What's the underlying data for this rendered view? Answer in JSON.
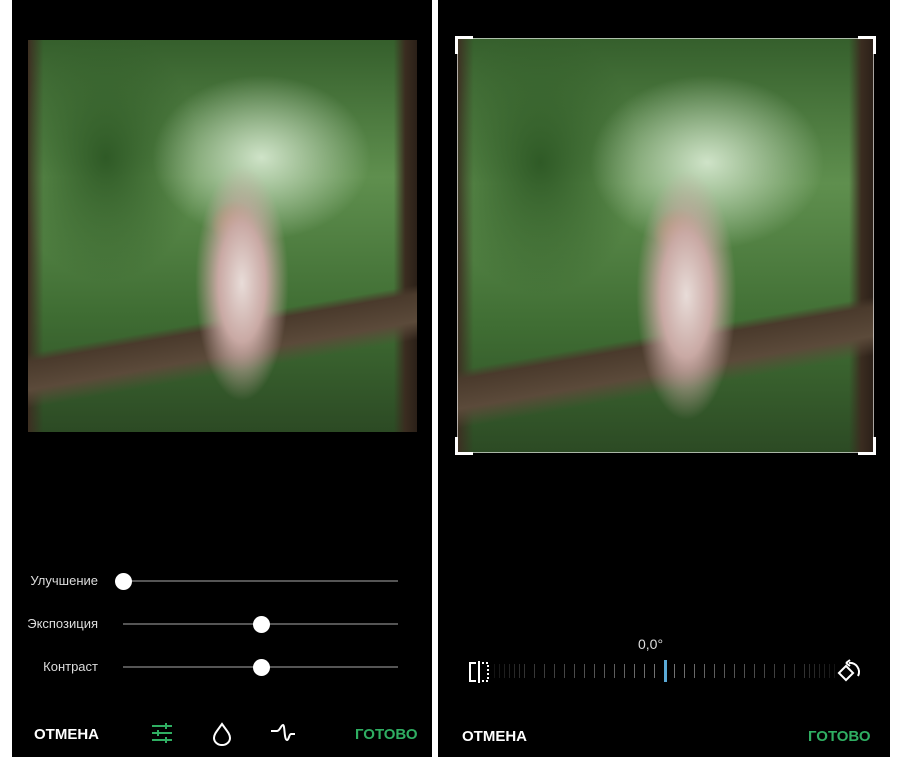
{
  "left_panel": {
    "sliders": [
      {
        "label": "Улучшение",
        "value": 0.0
      },
      {
        "label": "Экспозиция",
        "value": 0.5
      },
      {
        "label": "Контраст",
        "value": 0.5
      }
    ],
    "cancel_label": "ОТМЕНА",
    "done_label": "ГОТОВО",
    "tools": [
      "sliders-icon",
      "drop-icon",
      "curve-icon"
    ]
  },
  "right_panel": {
    "angle": "0,0°",
    "cancel_label": "ОТМЕНА",
    "done_label": "ГОТОВО"
  },
  "colors": {
    "accent": "#2fae62",
    "ruler_marker": "#5aa9d6"
  }
}
